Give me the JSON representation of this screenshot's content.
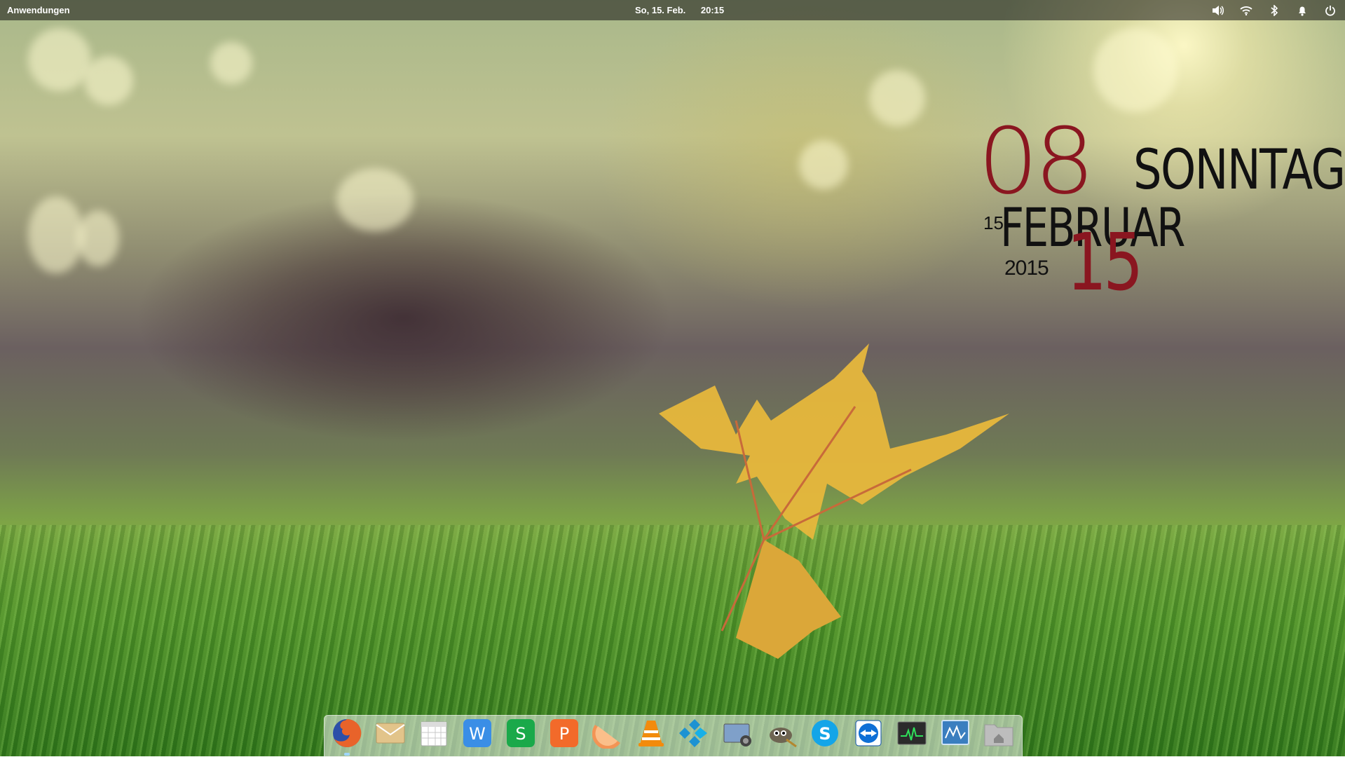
{
  "panel": {
    "apps_label": "Anwendungen",
    "date": "So, 15. Feb.",
    "time": "20:15",
    "tray": [
      "volume-icon",
      "wifi-icon",
      "bluetooth-icon",
      "notification-bell-icon",
      "power-icon"
    ]
  },
  "conky": {
    "hour": "08",
    "weekday": "SONNTAG",
    "day_small": "15",
    "month": "FEBRUAR",
    "year": "2015",
    "day_big": "15",
    "accent_color": "#8a1620",
    "text_color": "#111111"
  },
  "dock": {
    "items": [
      {
        "name": "firefox",
        "icon": "firefox-icon",
        "color": "#e8632a",
        "active": true
      },
      {
        "name": "mail",
        "icon": "mail-icon",
        "color": "#e2c48a"
      },
      {
        "name": "calendar",
        "icon": "calendar-icon",
        "color": "#dcdcdc"
      },
      {
        "name": "wps-writer",
        "icon": "writer-icon",
        "color": "#3a8ee6",
        "letter": "W"
      },
      {
        "name": "wps-spreadsheets",
        "icon": "spreadsheet-icon",
        "color": "#1aa94a",
        "letter": "S"
      },
      {
        "name": "wps-presentation",
        "icon": "presentation-icon",
        "color": "#f26a2a",
        "letter": "P"
      },
      {
        "name": "grapefruit",
        "icon": "grapefruit-icon",
        "color": "#f39455"
      },
      {
        "name": "vlc",
        "icon": "vlc-icon",
        "color": "#f28b0c"
      },
      {
        "name": "kodi",
        "icon": "kodi-icon",
        "color": "#1d92d2"
      },
      {
        "name": "screenshot",
        "icon": "screenshot-icon",
        "color": "#7fa0c9"
      },
      {
        "name": "gimp",
        "icon": "gimp-icon",
        "color": "#6e6552"
      },
      {
        "name": "skype",
        "icon": "skype-icon",
        "color": "#14a5e8",
        "letter": "S"
      },
      {
        "name": "teamviewer",
        "icon": "teamviewer-icon",
        "color": "#0e6fd6"
      },
      {
        "name": "system-monitor",
        "icon": "system-monitor-icon",
        "color": "#2b2b2b"
      },
      {
        "name": "activity-monitor",
        "icon": "activity-monitor-icon",
        "color": "#3a7ebf"
      },
      {
        "name": "home-folder",
        "icon": "home-folder-icon",
        "color": "#bdbdbd"
      }
    ]
  }
}
